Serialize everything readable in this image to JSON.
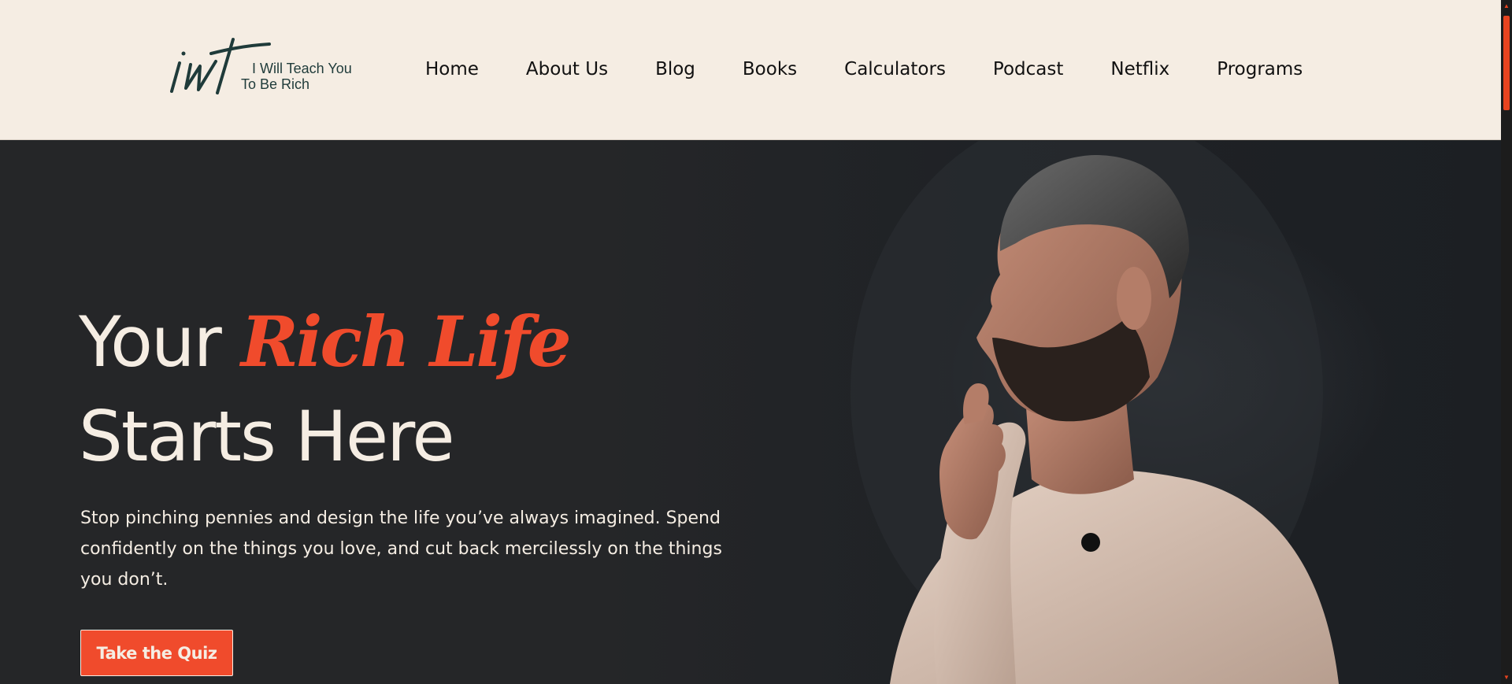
{
  "header": {
    "logo": {
      "mark": "iwt",
      "line1": "I Will Teach You",
      "line2": "To Be Rich"
    },
    "nav": [
      {
        "label": "Home"
      },
      {
        "label": "About Us"
      },
      {
        "label": "Blog"
      },
      {
        "label": "Books"
      },
      {
        "label": "Calculators"
      },
      {
        "label": "Podcast"
      },
      {
        "label": "Netflix"
      },
      {
        "label": "Programs"
      }
    ]
  },
  "hero": {
    "title_word": "Your",
    "title_accent": "Rich Life",
    "title_line2": "Starts Here",
    "description": "Stop pinching pennies and design the life you’ve always imagined. Spend confidently on the things you love, and cut back mercilessly on the things you don’t.",
    "cta_label": "Take the Quiz"
  },
  "colors": {
    "header_bg": "#f5ede3",
    "hero_bg": "#252628",
    "accent": "#f04b2c",
    "text_light": "#f5ede3",
    "logo_green": "#1f3b3a",
    "scrollbar_accent": "#e8431f"
  },
  "icons": {
    "scroll_up": "scroll-up-arrow-icon",
    "scroll_down": "scroll-down-arrow-icon"
  }
}
